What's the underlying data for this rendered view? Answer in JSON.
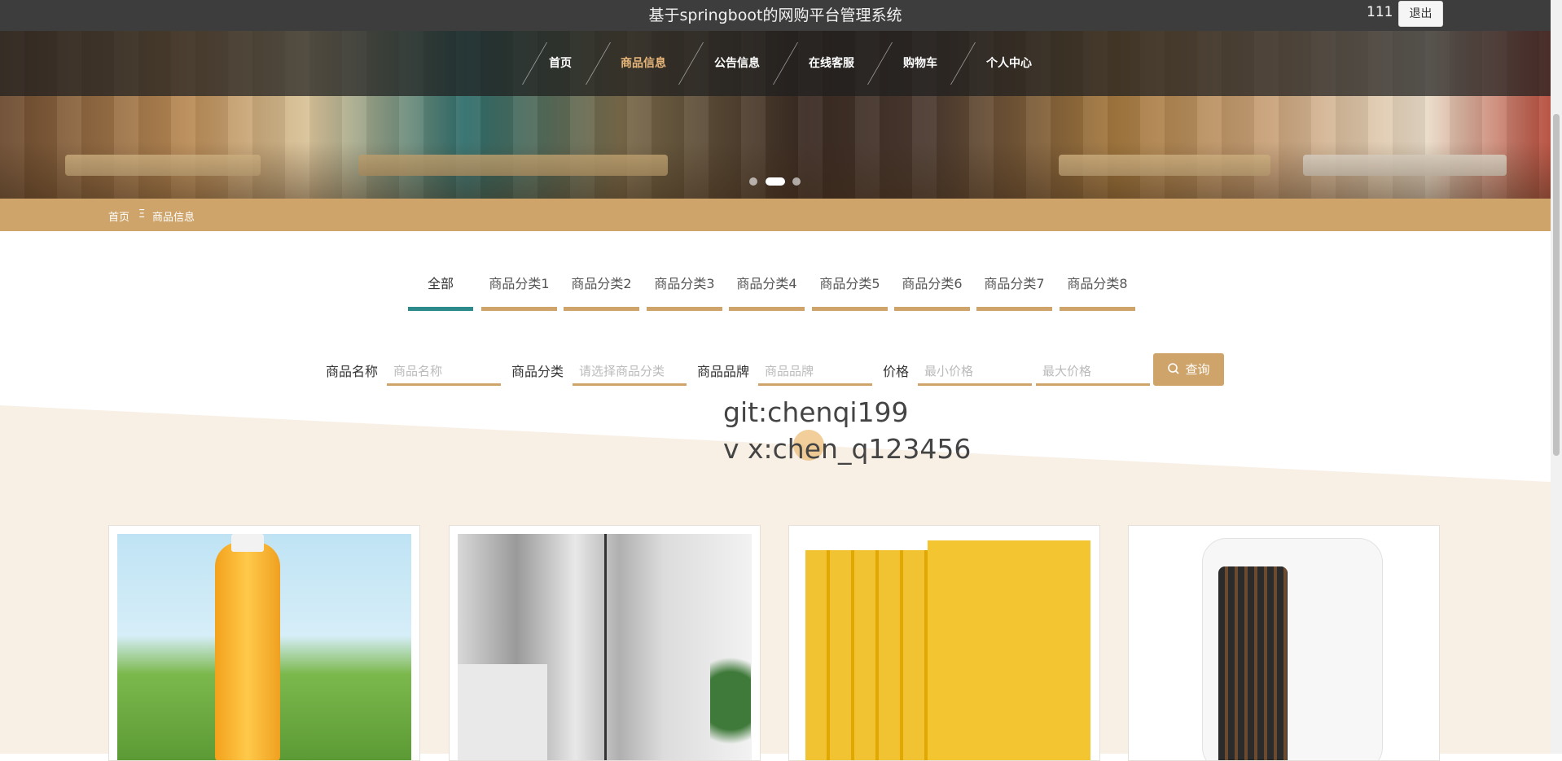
{
  "header": {
    "title": "基于springboot的网购平台管理系统",
    "user": "111",
    "logout": "退出"
  },
  "nav": [
    {
      "label": "首页"
    },
    {
      "label": "商品信息"
    },
    {
      "label": "公告信息"
    },
    {
      "label": "在线客服"
    },
    {
      "label": "购物车"
    },
    {
      "label": "个人中心"
    }
  ],
  "carousel": {
    "count": 3,
    "active": 2
  },
  "breadcrumb": {
    "home": "首页",
    "sep": "Ξ",
    "current": "商品信息"
  },
  "tabs": [
    "全部",
    "商品分类1",
    "商品分类2",
    "商品分类3",
    "商品分类4",
    "商品分类5",
    "商品分类6",
    "商品分类7",
    "商品分类8"
  ],
  "search": {
    "name_label": "商品名称",
    "name_placeholder": "商品名称",
    "category_label": "商品分类",
    "category_placeholder": "请选择商品分类",
    "brand_label": "商品品牌",
    "brand_placeholder": "商品品牌",
    "price_label": "价格",
    "min_placeholder": "最小价格",
    "max_placeholder": "最大价格",
    "button": "查询"
  },
  "watermark": {
    "line1": "git:chenqi199",
    "line2": "v x:chen_q123456"
  },
  "colors": {
    "accent": "#cfa46a",
    "active_tab": "#2d8a8a",
    "topbar": "#3d3d3d"
  },
  "products": [
    {
      "image": "mango-juice-bottle"
    },
    {
      "image": "refrigerator"
    },
    {
      "image": "book-set"
    },
    {
      "image": "space-heater"
    }
  ]
}
